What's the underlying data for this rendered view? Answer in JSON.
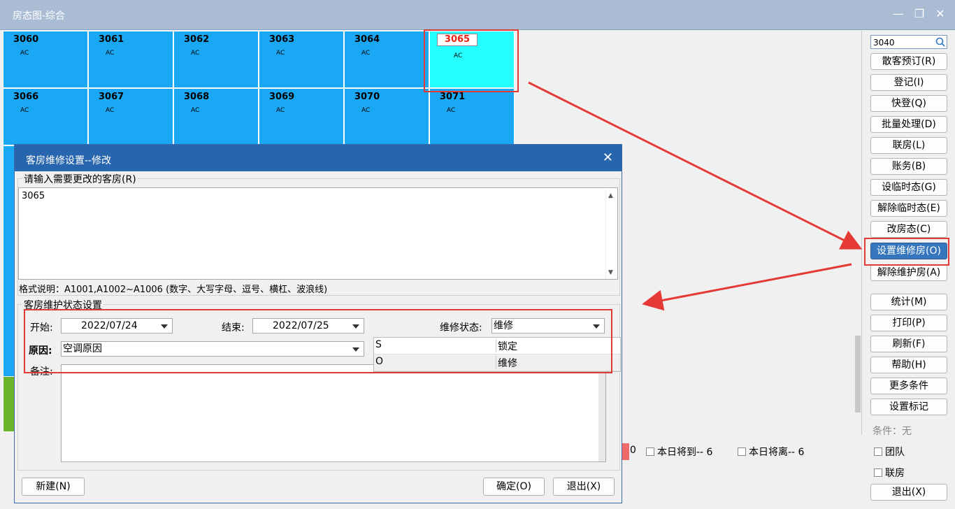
{
  "window": {
    "title": "房态图-综合",
    "minimize": "—",
    "restore": "❐",
    "close": "✕"
  },
  "rooms": [
    {
      "num": "3060",
      "tag": "AC"
    },
    {
      "num": "3061",
      "tag": "AC"
    },
    {
      "num": "3062",
      "tag": "AC"
    },
    {
      "num": "3063",
      "tag": "AC"
    },
    {
      "num": "3064",
      "tag": "AC"
    },
    {
      "num": "3065",
      "tag": "AC"
    },
    {
      "num": "3066",
      "tag": "AC"
    },
    {
      "num": "3067",
      "tag": "AC"
    },
    {
      "num": "3068",
      "tag": "AC"
    },
    {
      "num": "3069",
      "tag": "AC"
    },
    {
      "num": "3070",
      "tag": "AC"
    },
    {
      "num": "3071",
      "tag": "AC"
    }
  ],
  "sidebar": {
    "search_value": "3040",
    "buttons": [
      "散客预订(R)",
      "登记(I)",
      "快登(Q)",
      "批量处理(D)",
      "联房(L)",
      "账务(B)",
      "设临时态(G)",
      "解除临时态(E)",
      "改房态(C)",
      "设置维修房(O)",
      "解除维护房(A)",
      "统计(M)",
      "打印(P)",
      "刷新(F)",
      "帮助(H)",
      "更多条件",
      "设置标记"
    ],
    "condition": "条件：无",
    "check_team": "团队",
    "check_join": "联房",
    "exit": "退出(X)"
  },
  "bottom": {
    "c0": "0",
    "arrive": "本日将到-- 6",
    "leave": "本日将离-- 6"
  },
  "dialog": {
    "title": "客房维修设置--修改",
    "rooms_label": "请输入需要更改的客房(R)",
    "rooms_value": "3065",
    "format_note": "格式说明：A1001,A1002~A1006 (数字、大写字母、逗号、横杠、波浪线)",
    "status_group": "客房维护状态设置",
    "start_label": "开始:",
    "start_value": "2022/07/24",
    "end_label": "结束:",
    "end_value": "2022/07/25",
    "state_label": "维修状态:",
    "state_value": "维修",
    "reason_label": "原因:",
    "reason_value": "空调原因",
    "note_label": "备注:",
    "table": [
      {
        "code": "S",
        "name": "锁定"
      },
      {
        "code": "O",
        "name": "维修"
      }
    ],
    "new_btn": "新建(N)",
    "ok_btn": "确定(O)",
    "exit_btn": "退出(X)"
  }
}
